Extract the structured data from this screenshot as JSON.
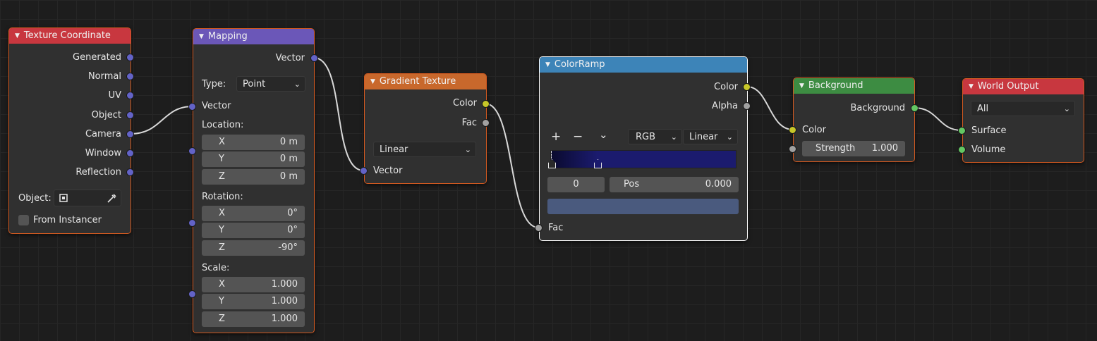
{
  "nodes": {
    "texture_coordinate": {
      "title": "Texture Coordinate",
      "outputs": [
        "Generated",
        "Normal",
        "UV",
        "Object",
        "Camera",
        "Window",
        "Reflection"
      ],
      "object_label": "Object:",
      "from_instancer_label": "From Instancer",
      "from_instancer_checked": false
    },
    "mapping": {
      "title": "Mapping",
      "output_vector": "Vector",
      "type_label": "Type:",
      "type_value": "Point",
      "input_vector": "Vector",
      "location_label": "Location:",
      "location": [
        {
          "axis": "X",
          "value": "0 m"
        },
        {
          "axis": "Y",
          "value": "0 m"
        },
        {
          "axis": "Z",
          "value": "0 m"
        }
      ],
      "rotation_label": "Rotation:",
      "rotation": [
        {
          "axis": "X",
          "value": "0°"
        },
        {
          "axis": "Y",
          "value": "0°"
        },
        {
          "axis": "Z",
          "value": "-90°"
        }
      ],
      "scale_label": "Scale:",
      "scale": [
        {
          "axis": "X",
          "value": "1.000"
        },
        {
          "axis": "Y",
          "value": "1.000"
        },
        {
          "axis": "Z",
          "value": "1.000"
        }
      ]
    },
    "gradient_texture": {
      "title": "Gradient Texture",
      "output_color": "Color",
      "output_fac": "Fac",
      "type_value": "Linear",
      "input_vector": "Vector"
    },
    "color_ramp": {
      "title": "ColorRamp",
      "output_color": "Color",
      "output_alpha": "Alpha",
      "add_icon": "+",
      "remove_icon": "−",
      "menu_icon": "⌄",
      "color_mode": "RGB",
      "interpolation": "Linear",
      "active_index": "0",
      "pos_label": "Pos",
      "pos_value": "0.000",
      "input_fac": "Fac",
      "ramp_start_color": "#0a0a2e",
      "ramp_end_color": "#1b1b6e",
      "active_stop_color": "#4a5a7e"
    },
    "background": {
      "title": "Background",
      "output_background": "Background",
      "input_color": "Color",
      "strength_label": "Strength",
      "strength_value": "1.000"
    },
    "world_output": {
      "title": "World Output",
      "target": "All",
      "input_surface": "Surface",
      "input_volume": "Volume"
    }
  },
  "icons": {
    "triangle": "▼",
    "chevron": "⌄"
  },
  "colors": {
    "socket_vector": "#6363c7",
    "socket_color": "#c7c729",
    "socket_float": "#a1a1a1",
    "socket_shader": "#63c763",
    "wire": "#d8d8d8"
  }
}
